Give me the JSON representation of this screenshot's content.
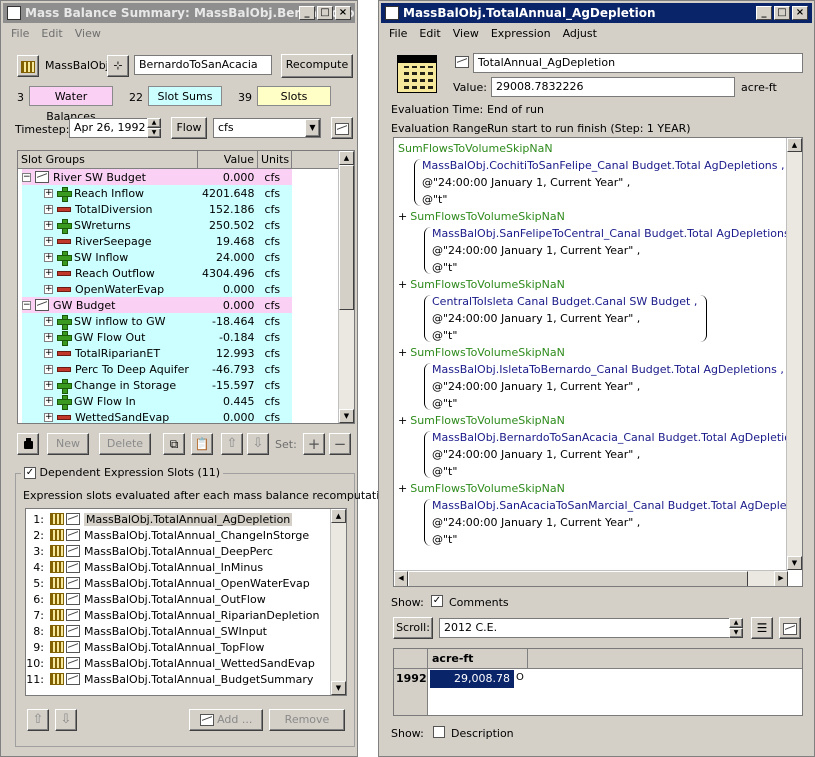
{
  "left_window": {
    "title": "Mass Balance Summary: MassBalObj.BernardoTo...",
    "menu": [
      "File",
      "Edit",
      "View"
    ],
    "object_label": "MassBalObj",
    "object_name": "BernardoToSanAcacia",
    "recompute_label": "Recompute",
    "counts": {
      "water_balances_count": "3",
      "water_balances_label": "Water Balances",
      "slot_sums_count": "22",
      "slot_sums_label": "Slot Sums",
      "slots_count": "39",
      "slots_label": "Slots"
    },
    "timestep_label": "Timestep:",
    "timestep_value": "Apr 26, 1992",
    "flow_label": "Flow",
    "units_value": "cfs",
    "tree_headers": [
      "Slot Groups",
      "Value",
      "Units"
    ],
    "tree_rows": [
      {
        "kind": "group",
        "icon": "graph-icon",
        "name": "River SW Budget",
        "value": "0.000",
        "unit": "cfs"
      },
      {
        "kind": "plus",
        "name": "Reach Inflow",
        "value": "4201.648",
        "unit": "cfs"
      },
      {
        "kind": "minus",
        "name": "TotalDiversion",
        "value": "152.186",
        "unit": "cfs"
      },
      {
        "kind": "plus",
        "name": "SWreturns",
        "value": "250.502",
        "unit": "cfs"
      },
      {
        "kind": "minus",
        "name": "RiverSeepage",
        "value": "19.468",
        "unit": "cfs"
      },
      {
        "kind": "plus",
        "name": "SW Inflow",
        "value": "24.000",
        "unit": "cfs"
      },
      {
        "kind": "minus",
        "name": "Reach Outflow",
        "value": "4304.496",
        "unit": "cfs"
      },
      {
        "kind": "minus",
        "name": "OpenWaterEvap",
        "value": "0.000",
        "unit": "cfs"
      },
      {
        "kind": "group",
        "icon": "graph-icon",
        "name": "GW Budget",
        "value": "0.000",
        "unit": "cfs"
      },
      {
        "kind": "plus",
        "name": "SW inflow to GW",
        "value": "-18.464",
        "unit": "cfs"
      },
      {
        "kind": "plus",
        "name": "GW Flow Out",
        "value": "-0.184",
        "unit": "cfs"
      },
      {
        "kind": "minus",
        "name": "TotalRiparianET",
        "value": "12.993",
        "unit": "cfs"
      },
      {
        "kind": "minus",
        "name": "Perc To Deep Aquifer",
        "value": "-46.793",
        "unit": "cfs"
      },
      {
        "kind": "plus",
        "name": "Change in Storage",
        "value": "-15.597",
        "unit": "cfs"
      },
      {
        "kind": "plus",
        "name": "GW Flow In",
        "value": "0.445",
        "unit": "cfs"
      },
      {
        "kind": "minus",
        "name": "WettedSandEvap",
        "value": "0.000",
        "unit": "cfs"
      }
    ],
    "toolbar": {
      "new_label": "New",
      "delete_label": "Delete",
      "set_label": "Set:"
    },
    "dependent_label": "Dependent Expression Slots (11)",
    "dependent_caption": "Expression slots evaluated after each mass balance recomputation:",
    "dependent_items": [
      {
        "num": "1:",
        "name": "MassBalObj.TotalAnnual_AgDepletion"
      },
      {
        "num": "2:",
        "name": "MassBalObj.TotalAnnual_ChangeInStorge"
      },
      {
        "num": "3:",
        "name": "MassBalObj.TotalAnnual_DeepPerc"
      },
      {
        "num": "4:",
        "name": "MassBalObj.TotalAnnual_InMinus"
      },
      {
        "num": "5:",
        "name": "MassBalObj.TotalAnnual_OpenWaterEvap"
      },
      {
        "num": "6:",
        "name": "MassBalObj.TotalAnnual_OutFlow"
      },
      {
        "num": "7:",
        "name": "MassBalObj.TotalAnnual_RiparianDepletion"
      },
      {
        "num": "8:",
        "name": "MassBalObj.TotalAnnual_SWInput"
      },
      {
        "num": "9:",
        "name": "MassBalObj.TotalAnnual_TopFlow"
      },
      {
        "num": "10:",
        "name": "MassBalObj.TotalAnnual_WettedSandEvap"
      },
      {
        "num": "11:",
        "name": "MassBalObj.TotalAnnual_BudgetSummary"
      }
    ],
    "add_label": "Add ...",
    "remove_label": "Remove"
  },
  "right_window": {
    "title": "MassBalObj.TotalAnnual_AgDepletion",
    "menu": [
      "File",
      "Edit",
      "View",
      "Expression",
      "Adjust"
    ],
    "slot_name": "TotalAnnual_AgDepletion",
    "value_label": "Value:",
    "value": "29008.7832226",
    "value_unit": "acre-ft",
    "eval_time_label": "Evaluation Time:",
    "eval_time_value": "End of run",
    "eval_range_label": "Evaluation Range:",
    "eval_range_value": "Run start to run finish (Step: 1 YEAR)",
    "func_name": "SumFlowsToVolumeSkipNaN",
    "plus": "+",
    "terms": [
      {
        "slot": "MassBalObj.CochitiToSanFelipe_Canal Budget.Total AgDepletions ,",
        "date": "@\"24:00:00 January 1, Current Year\" ,",
        "t": "@\"t\""
      },
      {
        "slot": "MassBalObj.SanFelipeToCentral_Canal Budget.Total AgDepletions ,",
        "date": "@\"24:00:00 January 1, Current Year\" ,",
        "t": "@\"t\""
      },
      {
        "slot": "CentralToIsleta Canal Budget.Canal SW Budget ,",
        "date": "@\"24:00:00 January 1, Current Year\" ,",
        "t": "@\"t\""
      },
      {
        "slot": "MassBalObj.IsletaToBernardo_Canal Budget.Total AgDepletions ,",
        "date": "@\"24:00:00 January 1, Current Year\" ,",
        "t": "@\"t\""
      },
      {
        "slot": "MassBalObj.BernardoToSanAcacia_Canal Budget.Total AgDepletions ,",
        "date": "@\"24:00:00 January 1, Current Year\" ,",
        "t": "@\"t\""
      },
      {
        "slot": "MassBalObj.SanAcaciaToSanMarcial_Canal Budget.Total AgDepletions ,",
        "date": "@\"24:00:00 January 1, Current Year\" ,",
        "t": "@\"t\""
      }
    ],
    "show_label": "Show:",
    "comments_label": "Comments",
    "scroll_label": "Scroll:",
    "scroll_value": "2012 C.E.",
    "table_header": "acre-ft",
    "table_row_label": "1992",
    "table_value": "29,008.78",
    "table_flag": "O",
    "description_label": "Description",
    "colors": {
      "title_active": "#0a246a",
      "selection": "#0a246a",
      "group_row": "#fbd0f5",
      "item_row": "#ccffff"
    }
  }
}
